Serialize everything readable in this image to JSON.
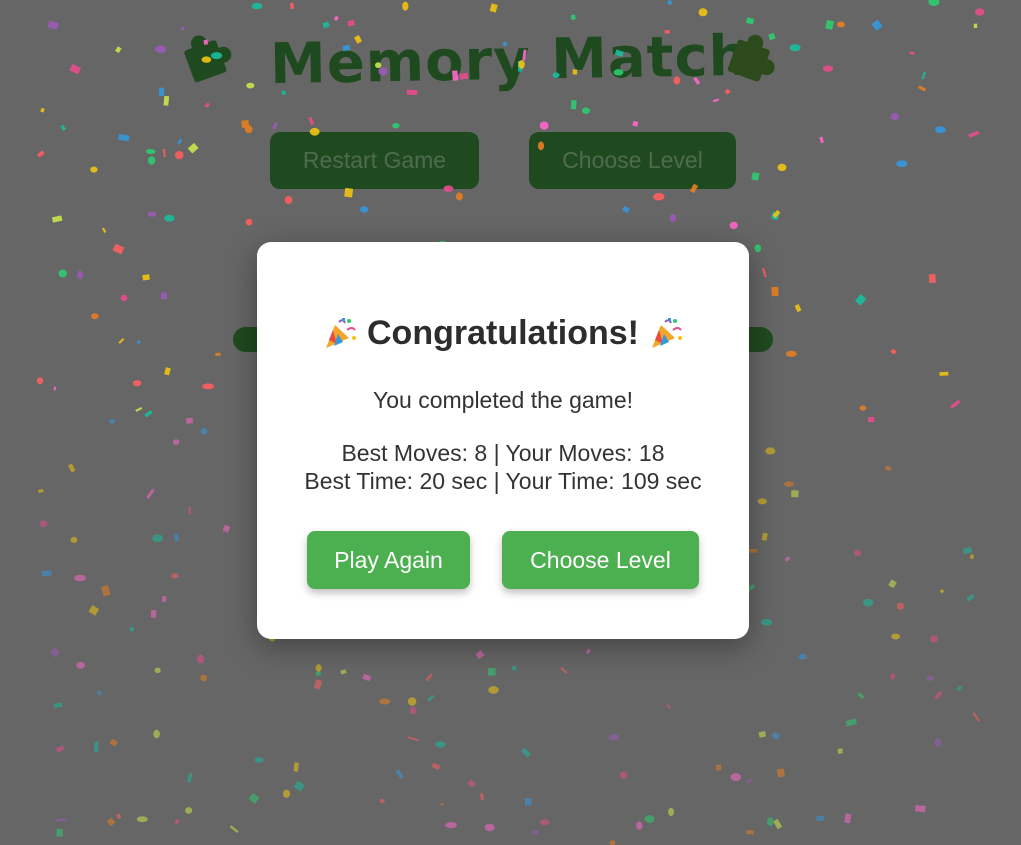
{
  "game": {
    "title": "Memory Match",
    "title_icon": "puzzle-piece-icon",
    "restart_label": "Restart Game",
    "choose_level_label": "Choose Level"
  },
  "modal": {
    "title": "Congratulations!",
    "title_icon": "party-popper-icon",
    "message": "You completed the game!",
    "stats_moves": "Best Moves: 8 | Your Moves: 18",
    "stats_time": "Best Time: 20 sec | Your Time: 109 sec",
    "play_again_label": "Play Again",
    "choose_level_label": "Choose Level"
  },
  "stats": {
    "best_moves": 8,
    "your_moves": 18,
    "best_time_sec": 20,
    "your_time_sec": 109
  },
  "colors": {
    "overlay_background": "#666666",
    "button_green": "#4caf50",
    "dimmed_green": "#1f4a1f",
    "modal_background": "#ffffff",
    "text": "#333333",
    "confetti": [
      "#e74c8b",
      "#f1c40f",
      "#3498db",
      "#2ecc71",
      "#9b59b6",
      "#e67e22",
      "#1abc9c",
      "#ff5e5e",
      "#c8e64a",
      "#ff66cc"
    ]
  }
}
